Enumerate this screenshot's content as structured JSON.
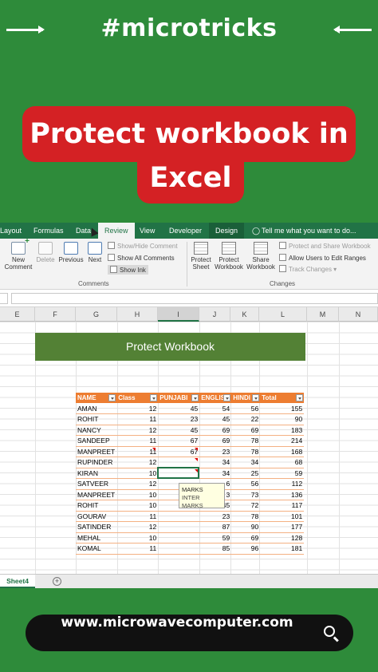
{
  "header": {
    "hashtag": "#microtricks"
  },
  "title": {
    "line1": "Protect workbook in",
    "line2": "Excel"
  },
  "ribbon_tabs": [
    "Layout",
    "Formulas",
    "Data",
    "Review",
    "View",
    "Developer",
    "Design"
  ],
  "tell_me": "Tell me what you want to do...",
  "ribbon": {
    "new_comment": "New Comment",
    "delete": "Delete",
    "previous": "Previous",
    "next": "Next",
    "show_hide_comment": "Show/Hide Comment",
    "show_all_comments": "Show All Comments",
    "show_ink": "Show Ink",
    "comments_group": "Comments",
    "protect_sheet": "Protect Sheet",
    "protect_workbook": "Protect Workbook",
    "share_workbook": "Share Workbook",
    "protect_and_share": "Protect and Share Workbook",
    "allow_users": "Allow Users to Edit Ranges",
    "track_changes": "Track Changes",
    "changes_group": "Changes"
  },
  "columns": [
    "E",
    "F",
    "G",
    "H",
    "I",
    "J",
    "K",
    "L",
    "M",
    "N"
  ],
  "banner": "Protect Workbook",
  "table": {
    "headers": [
      "NAME",
      "Class",
      "PUNJABI",
      "ENGLISH",
      "HINDI",
      "Total"
    ],
    "rows": [
      [
        "AMAN",
        "12",
        "45",
        "54",
        "56",
        "155"
      ],
      [
        "ROHIT",
        "11",
        "23",
        "45",
        "22",
        "90"
      ],
      [
        "NANCY",
        "12",
        "45",
        "69",
        "69",
        "183"
      ],
      [
        "SANDEEP",
        "11",
        "67",
        "69",
        "78",
        "214"
      ],
      [
        "MANPREET",
        "11",
        "67",
        "23",
        "78",
        "168"
      ],
      [
        "RUPINDER",
        "12",
        "",
        "34",
        "34",
        "68"
      ],
      [
        "KIRAN",
        "10",
        "",
        "34",
        "25",
        "59"
      ],
      [
        "SATVEER",
        "12",
        "",
        "6",
        "56",
        "112"
      ],
      [
        "MANPREET",
        "10",
        "",
        "3",
        "73",
        "136"
      ],
      [
        "ROHIT",
        "10",
        "",
        "45",
        "72",
        "117"
      ],
      [
        "GOURAV",
        "11",
        "",
        "23",
        "78",
        "101"
      ],
      [
        "SATINDER",
        "12",
        "",
        "87",
        "90",
        "177"
      ],
      [
        "MEHAL",
        "10",
        "",
        "59",
        "69",
        "128"
      ],
      [
        "KOMAL",
        "11",
        "",
        "85",
        "96",
        "181"
      ]
    ]
  },
  "tooltip": {
    "title": "MARKS",
    "subtitle": "INTER MARKS"
  },
  "sheet_tab": "Sheet4",
  "add_sheet": "+",
  "footer": {
    "url": "www.microwavecomputer.com"
  },
  "colors": {
    "background": "#2e8b3a",
    "title_red": "#d42124",
    "excel_green": "#217346",
    "table_orange": "#ed7d31",
    "banner_green": "#538135"
  }
}
